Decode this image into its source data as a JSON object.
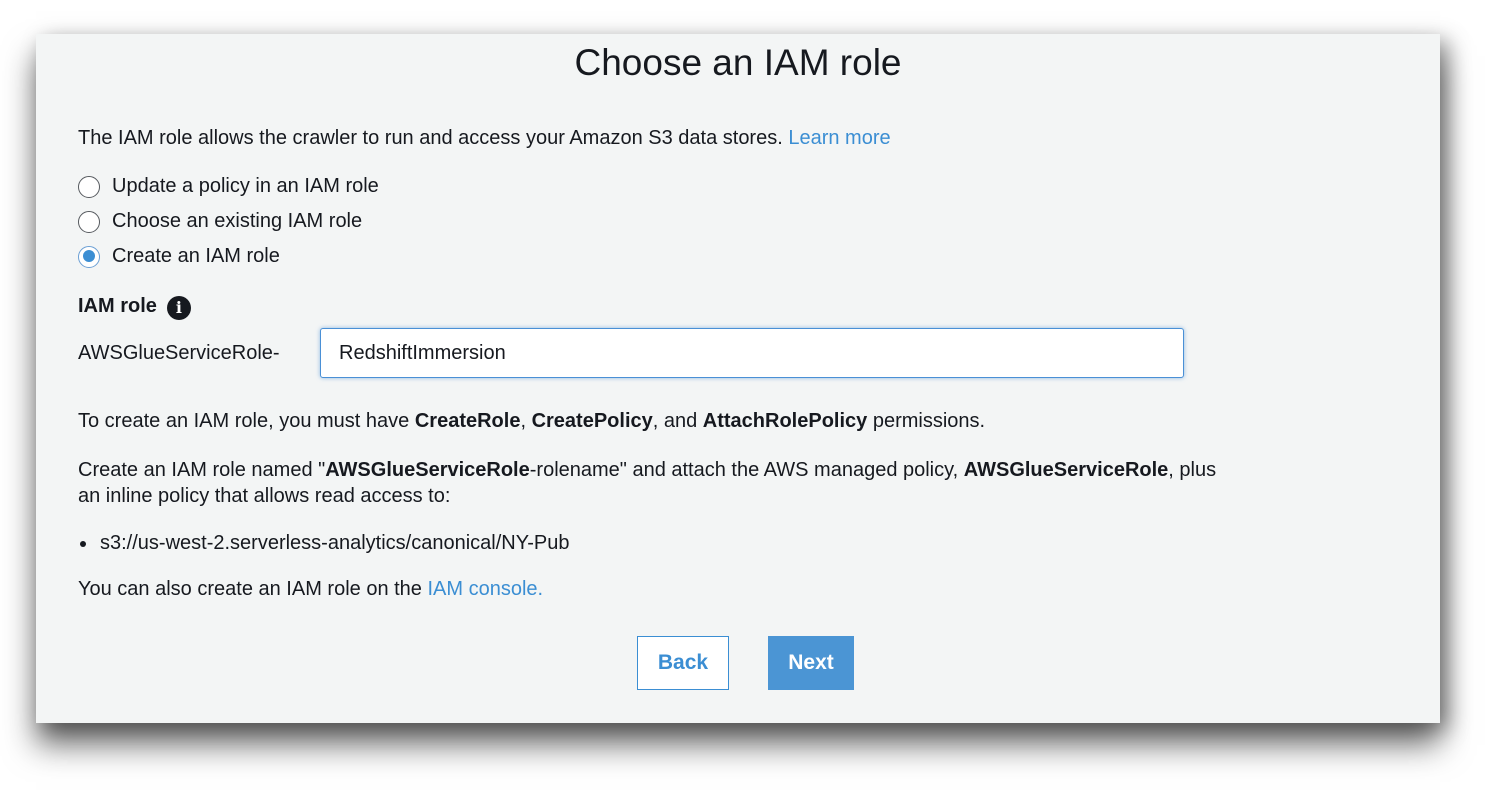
{
  "title": "Choose an IAM role",
  "intro": {
    "text": "The IAM role allows the crawler to run and access your Amazon S3 data stores.",
    "link": "Learn more"
  },
  "options": [
    {
      "label": "Update a policy in an IAM role",
      "checked": false
    },
    {
      "label": "Choose an existing IAM role",
      "checked": false
    },
    {
      "label": "Create an IAM role",
      "checked": true
    }
  ],
  "iam_role": {
    "label": "IAM role",
    "info_icon": "info-icon",
    "prefix": "AWSGlueServiceRole-",
    "value": "RedshiftImmersion"
  },
  "permissions": {
    "pre": "To create an IAM role, you must have",
    "p1": "CreateRole",
    "sep1": ",",
    "p2": "CreatePolicy",
    "sep2": ", and",
    "p3": "AttachRolePolicy",
    "post": "permissions."
  },
  "create_text": {
    "pre": "Create an IAM role named \"",
    "bold1": "AWSGlueServiceRole",
    "mid": "-rolename\" and attach the AWS managed policy,",
    "bold2": "AWSGlueServiceRole",
    "post": ", plus",
    "line2": "an inline policy that allows read access to:"
  },
  "paths": [
    "s3://us-west-2.serverless-analytics/canonical/NY-Pub"
  ],
  "console": {
    "text": "You can also create an IAM role on the",
    "link": "IAM console."
  },
  "buttons": {
    "back": "Back",
    "next": "Next"
  },
  "colors": {
    "link": "#3b8ed3",
    "primary_button": "#4b95d4",
    "panel_bg": "#f3f5f5"
  }
}
